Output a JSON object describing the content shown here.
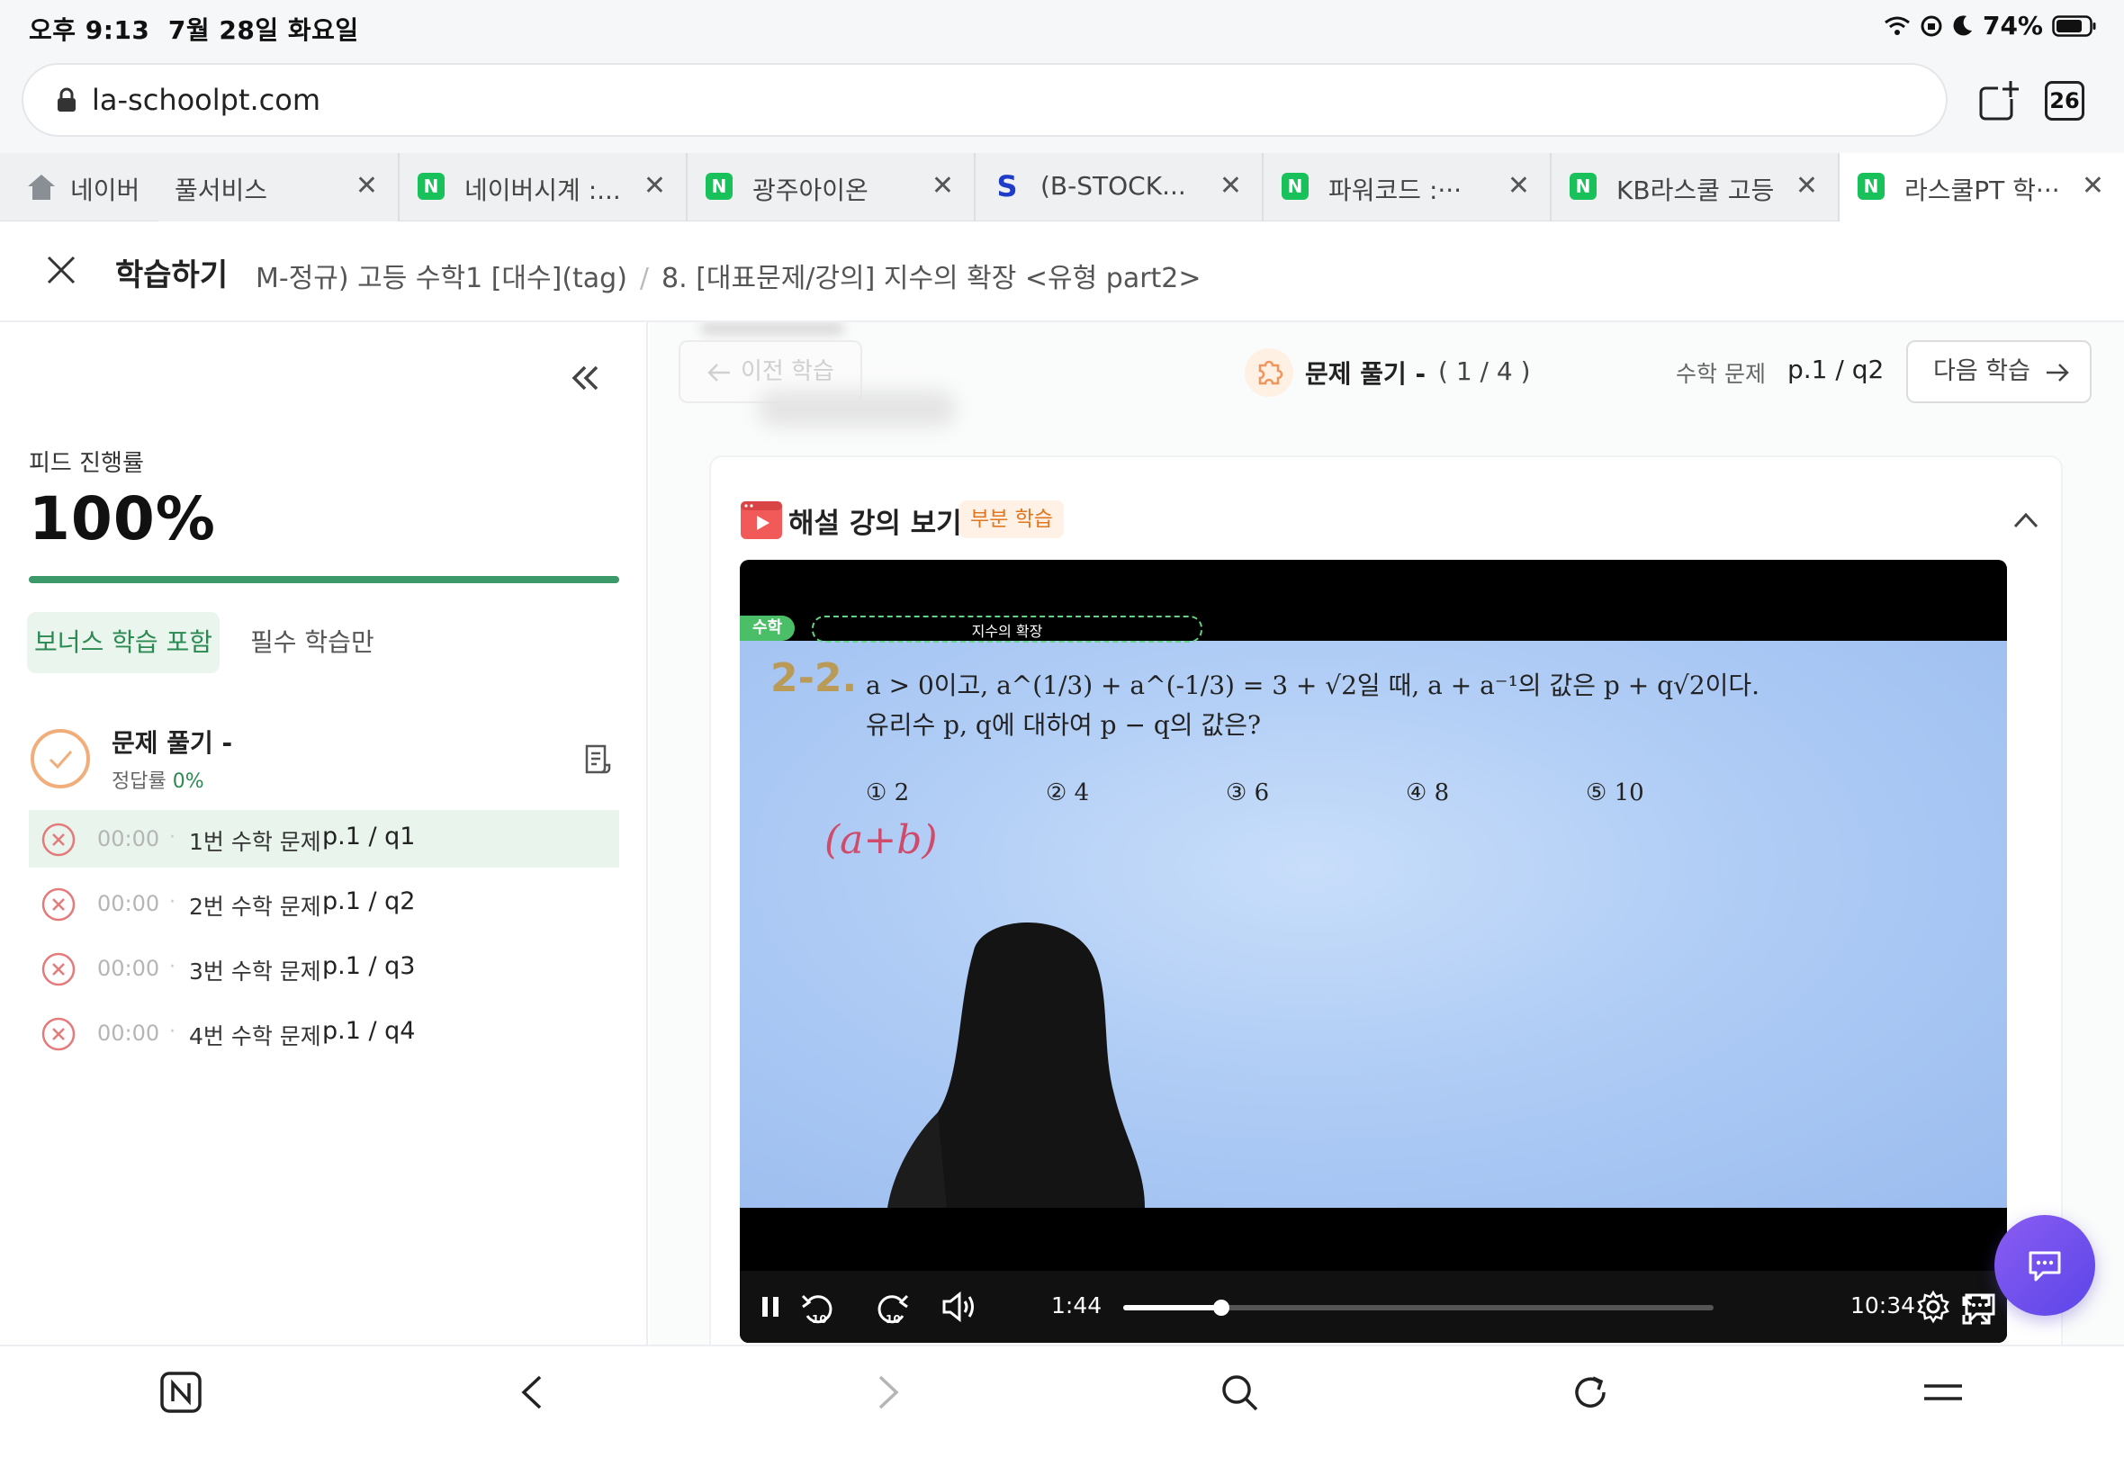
{
  "status": {
    "time": "오후 9:13",
    "date": "7월 28일 화요일",
    "battery": "74%"
  },
  "browser": {
    "url": "la-schoolpt.com",
    "tab_count": "26",
    "tabs": [
      {
        "label": "네이버",
        "icon": "home-icon"
      },
      {
        "label": "풀서비스",
        "icon": ""
      },
      {
        "label": "네이버시계 :...",
        "icon": "N"
      },
      {
        "label": "광주아이온",
        "icon": "N"
      },
      {
        "label": "(B-STOCK...",
        "icon": "S"
      },
      {
        "label": "파워코드 :···",
        "icon": "N"
      },
      {
        "label": "KB라스쿨 고등",
        "icon": "N"
      },
      {
        "label": "라스쿨PT 학···",
        "icon": "N"
      }
    ]
  },
  "header": {
    "title": "학습하기",
    "breadcrumb_course": "M-정규) 고등 수학1 [대수](tag)",
    "breadcrumb_lesson": "8. [대표문제/강의] 지수의 확장 <유형 part2>"
  },
  "sidebar": {
    "progress_label": "피드 진행률",
    "progress_value": "100%",
    "progress_fraction": 1.0,
    "filter_bonus": "보너스 학습 포함",
    "filter_required": "필수 학습만",
    "section_title": "문제 풀기 -",
    "section_accuracy_label": "정답률",
    "section_accuracy_value": "0%",
    "questions": [
      {
        "time": "00:00",
        "name": "1번 수학 문제",
        "page": "p.1 / q1",
        "active": true
      },
      {
        "time": "00:00",
        "name": "2번 수학 문제",
        "page": "p.1 / q2",
        "active": false
      },
      {
        "time": "00:00",
        "name": "3번 수학 문제",
        "page": "p.1 / q3",
        "active": false
      },
      {
        "time": "00:00",
        "name": "4번 수학 문제",
        "page": "p.1 / q4",
        "active": false
      }
    ]
  },
  "main": {
    "prev_label": "이전 학습",
    "problem_title": "문제 풀기 -",
    "problem_count": "( 1 / 4 )",
    "problem_category": "수학 문제",
    "problem_page": "p.1 / q2",
    "next_label": "다음 학습",
    "lecture_title": "해설 강의 보기",
    "lecture_badge": "부분 학습"
  },
  "video": {
    "subject_tag": "수학",
    "topic": "지수의 확장",
    "problem_number": "2-2.",
    "problem_line1": "a > 0이고, a^(1/3) + a^(-1/3) = 3 + √2일 때, a + a⁻¹의 값은 p + q√2이다.",
    "problem_line2": "유리수 p, q에 대하여 p − q의 값은?",
    "choices": [
      "① 2",
      "② 4",
      "③ 6",
      "④ 8",
      "⑤ 10"
    ],
    "handwriting": "(a+b)",
    "current_time": "1:44",
    "total_time": "10:34",
    "played_fraction": 0.166
  }
}
